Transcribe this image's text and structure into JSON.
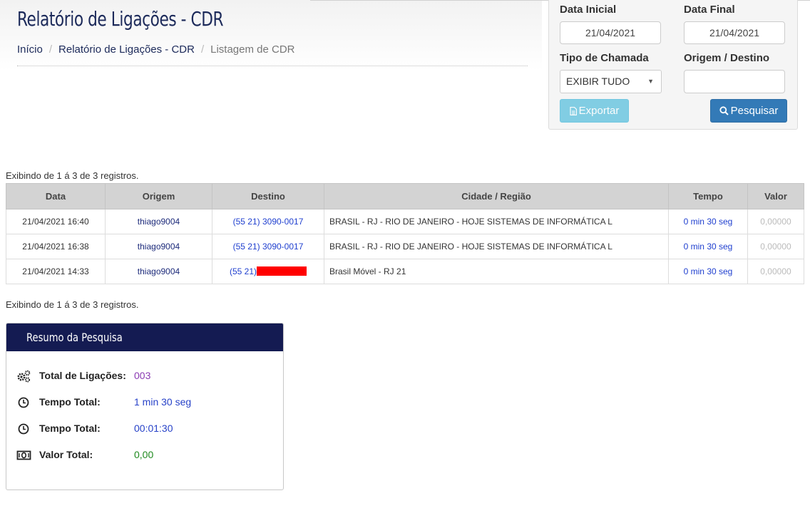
{
  "header": {
    "title": "Relatório de Ligações - CDR",
    "breadcrumb": [
      "Início",
      "Relatório de Ligações - CDR",
      "Listagem de CDR"
    ]
  },
  "filters": {
    "data_inicial_label": "Data Inicial",
    "data_inicial_value": "21/04/2021",
    "data_final_label": "Data Final",
    "data_final_value": "21/04/2021",
    "tipo_label": "Tipo de Chamada",
    "tipo_value": "EXIBIR TUDO",
    "origem_destino_label": "Origem / Destino",
    "origem_destino_value": "",
    "export_label": "Exportar",
    "search_label": "Pesquisar"
  },
  "listing": {
    "info_top": "Exibindo de 1 á 3 de 3 registros.",
    "info_bottom": "Exibindo de 1 á 3 de 3 registros.",
    "columns": [
      "Data",
      "Origem",
      "Destino",
      "Cidade / Região",
      "Tempo",
      "Valor"
    ],
    "rows": [
      {
        "data": "21/04/2021 16:40",
        "origem": "thiago9004",
        "destino": "(55 21) 3090-0017",
        "cidade": "BRASIL - RJ - RIO DE JANEIRO - HOJE SISTEMAS DE INFORMÁTICA L",
        "tempo": "0 min 30 seg",
        "valor": "0,00000"
      },
      {
        "data": "21/04/2021 16:38",
        "origem": "thiago9004",
        "destino": "(55 21) 3090-0017",
        "cidade": "BRASIL - RJ - RIO DE JANEIRO - HOJE SISTEMAS DE INFORMÁTICA L",
        "tempo": "0 min 30 seg",
        "valor": "0,00000"
      },
      {
        "data": "21/04/2021 14:33",
        "origem": "thiago9004",
        "destino": "(55 21)",
        "cidade": "Brasil Móvel - RJ 21",
        "tempo": "0 min 30 seg",
        "valor": "0,00000"
      }
    ]
  },
  "summary": {
    "title": "Resumo da Pesquisa",
    "total_ligacoes_label": "Total de Ligações:",
    "total_ligacoes_value": "003",
    "tempo_total_label": "Tempo Total:",
    "tempo_total_value": "1 min 30 seg",
    "tempo_total2_label": "Tempo Total:",
    "tempo_total2_value": "00:01:30",
    "valor_total_label": "Valor Total:",
    "valor_total_value": "0,00"
  },
  "colors": {
    "title": "#1c2a5a",
    "summary_header": "#141b52",
    "search_button": "#337ab7",
    "export_button": "#5bc0de",
    "link_blue": "#1f3fcf",
    "redaction": "#ff0000"
  },
  "icons": [
    "file-icon",
    "search-icon",
    "gears-icon",
    "clock-icon",
    "money-icon"
  ]
}
